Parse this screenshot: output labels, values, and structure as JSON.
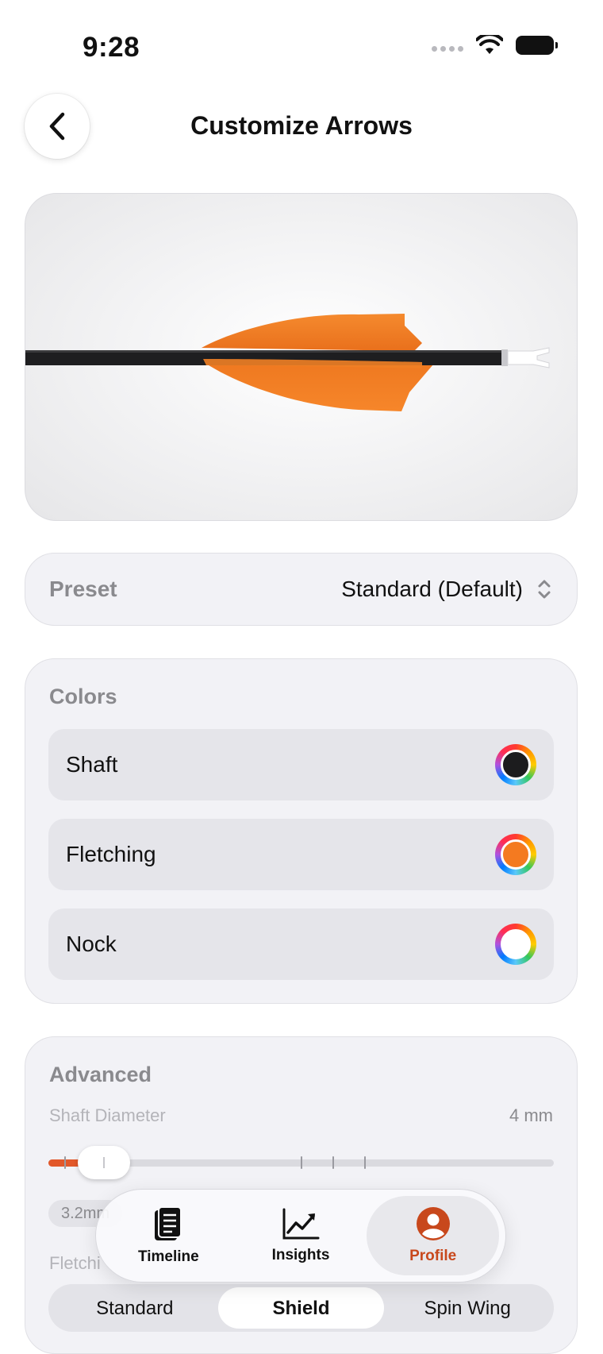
{
  "status": {
    "time": "9:28"
  },
  "nav": {
    "title": "Customize Arrows"
  },
  "preset": {
    "label": "Preset",
    "value": "Standard (Default)"
  },
  "colors": {
    "title": "Colors",
    "items": [
      {
        "label": "Shaft",
        "color": "#1c1c1e"
      },
      {
        "label": "Fletching",
        "color": "#f47a20"
      },
      {
        "label": "Nock",
        "color": "#ffffff"
      }
    ]
  },
  "advanced": {
    "title": "Advanced",
    "shaft_diameter": {
      "label": "Shaft Diameter",
      "value": "4 mm",
      "chip": "3.2mm"
    },
    "fletching_label": "Fletchi",
    "fletching_options": [
      "Standard",
      "Shield",
      "Spin Wing"
    ],
    "fletching_selected": "Shield"
  },
  "tabbar": {
    "tabs": [
      {
        "label": "Timeline",
        "icon": "document-icon"
      },
      {
        "label": "Insights",
        "icon": "chart-icon"
      },
      {
        "label": "Profile",
        "icon": "person-icon",
        "active": true
      }
    ]
  },
  "accent": "#c8481c"
}
